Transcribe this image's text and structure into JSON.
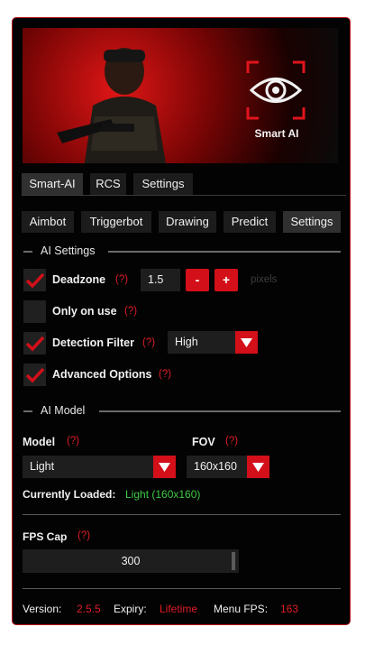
{
  "banner": {
    "logo_text": "Smart AI"
  },
  "top_tabs": [
    {
      "label": "Smart-AI",
      "active": true
    },
    {
      "label": "RCS",
      "active": false
    },
    {
      "label": "Settings",
      "active": false
    }
  ],
  "sub_tabs": [
    {
      "label": "Aimbot",
      "active": false
    },
    {
      "label": "Triggerbot",
      "active": false
    },
    {
      "label": "Drawing",
      "active": false
    },
    {
      "label": "Predict",
      "active": false
    },
    {
      "label": "Settings",
      "active": true
    }
  ],
  "ai_settings": {
    "header": "AI Settings",
    "help": "(?)",
    "deadzone": {
      "label": "Deadzone",
      "checked": true,
      "value": "1.5",
      "minus": "-",
      "plus": "+",
      "unit": "pixels"
    },
    "only_on_use": {
      "label": "Only on use",
      "checked": false
    },
    "detection_filter": {
      "label": "Detection Filter",
      "checked": true,
      "selected": "High"
    },
    "advanced_options": {
      "label": "Advanced Options",
      "checked": true
    }
  },
  "ai_model": {
    "header": "AI Model",
    "model_label": "Model",
    "model_selected": "Light",
    "fov_label": "FOV",
    "fov_selected": "160x160",
    "loaded_label": "Currently Loaded:",
    "loaded_value": "Light (160x160)"
  },
  "fps_cap": {
    "label": "FPS Cap",
    "value": "300",
    "fraction": 0.96
  },
  "footer": {
    "version_label": "Version:",
    "version_value": "2.5.5",
    "expiry_label": "Expiry:",
    "expiry_value": "Lifetime",
    "fps_label": "Menu FPS:",
    "fps_value": "163"
  },
  "colors": {
    "accent": "#d30f19",
    "help": "#e01d26",
    "loaded": "#3ecb45",
    "border": "#b31018"
  }
}
